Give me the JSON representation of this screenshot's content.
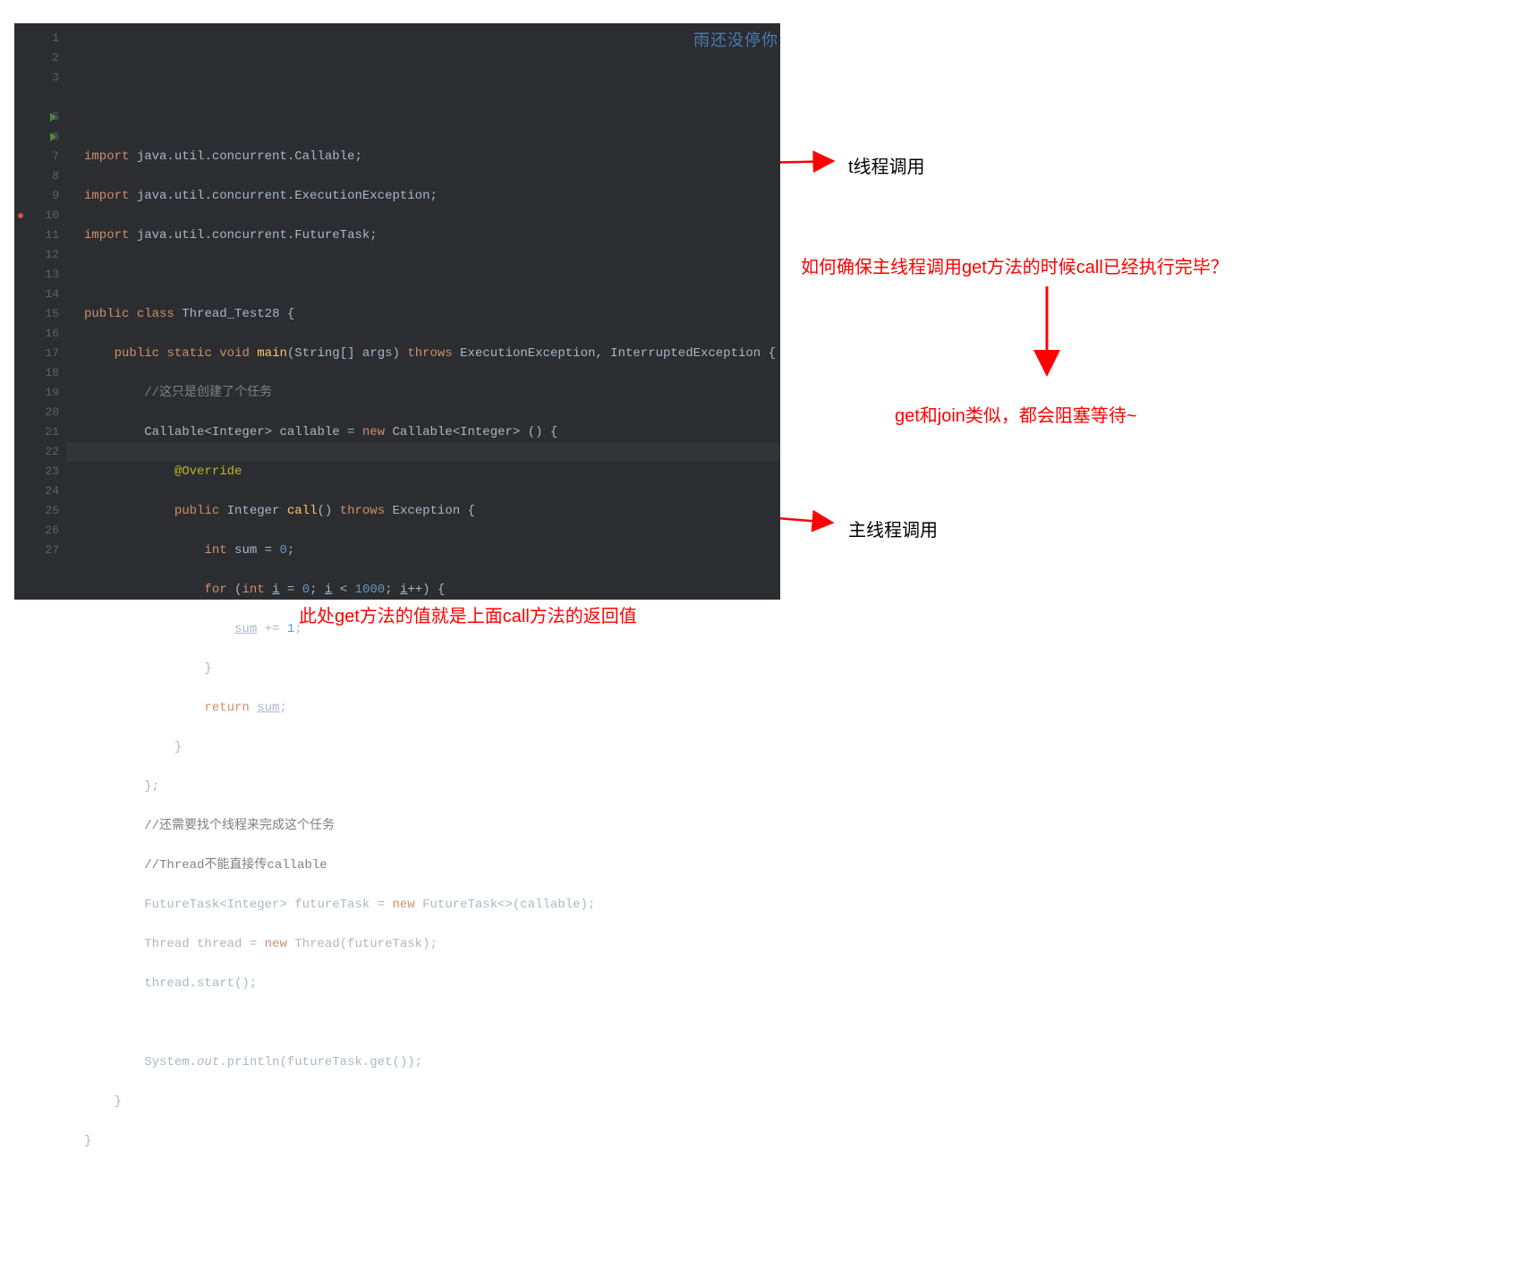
{
  "watermark": "雨还没停你",
  "lines": {
    "l1": {
      "num": "1",
      "imp": "import",
      "pkg": "java.util.concurrent.Callable;"
    },
    "l2": {
      "num": "2",
      "imp": "import",
      "pkg": "java.util.concurrent.ExecutionException;"
    },
    "l3": {
      "num": "3",
      "imp": "import",
      "pkg": "java.util.concurrent.FutureTask;"
    },
    "l4": {
      "num": ""
    },
    "l5": {
      "num": "5",
      "a": "public",
      "b": "class",
      "c": "Thread_Test28",
      "d": "{"
    },
    "l6": {
      "num": "6",
      "a": "public",
      "b": "static",
      "c": "void",
      "d": "main",
      "e": "(String[] args)",
      "f": "throws",
      "g": "ExecutionException, InterruptedException {"
    },
    "l7": {
      "num": "7",
      "cmt": "//这只是创建了个任务"
    },
    "l8": {
      "num": "8",
      "a": "Callable<Integer> callable = ",
      "b": "new",
      "c": " Callable<Integer> () {"
    },
    "l9": {
      "num": "9",
      "ann": "@Override"
    },
    "l10": {
      "num": "10",
      "a": "public",
      "b": " Integer ",
      "c": "call",
      "d": "() ",
      "e": "throws",
      "f": " Exception {"
    },
    "l11": {
      "num": "11",
      "a": "int",
      "b": " sum = ",
      "c": "0",
      "d": ";"
    },
    "l12": {
      "num": "12",
      "a": "for",
      "b": " (",
      "c": "int",
      "d": " ",
      "e": "i",
      "f": " = ",
      "g": "0",
      "h": "; ",
      "i": "i",
      "j": " < ",
      "k": "1000",
      "l": "; ",
      "m": "i",
      "n": "++) {"
    },
    "l13": {
      "num": "13",
      "a": "sum",
      "b": " += ",
      "c": "1",
      "d": ";"
    },
    "l14": {
      "num": "14",
      "a": "}"
    },
    "l15": {
      "num": "15",
      "a": "return",
      "b": " ",
      "c": "sum",
      "d": ";"
    },
    "l16": {
      "num": "16",
      "a": "}"
    },
    "l17": {
      "num": "17",
      "a": "};"
    },
    "l18": {
      "num": "18",
      "cmt": "//还需要找个线程来完成这个任务"
    },
    "l19": {
      "num": "19",
      "cmt": "//Thread不能直接传callable"
    },
    "l20": {
      "num": "20",
      "a": "FutureTask<Integer> futureTask = ",
      "b": "new",
      "c": " FutureTask<>(callable);"
    },
    "l21": {
      "num": "21",
      "a": "Thread thread = ",
      "b": "new",
      "c": " Thread(futureTask);"
    },
    "l22": {
      "num": "22",
      "a": "thread.start();"
    },
    "l23": {
      "num": "23"
    },
    "l24": {
      "num": "24",
      "a": "System.",
      "b": "out",
      "c": ".println(futureTask.get());"
    },
    "l25": {
      "num": "25",
      "a": "}"
    },
    "l26": {
      "num": "26",
      "a": "}"
    },
    "l27": {
      "num": "27"
    }
  },
  "annotations": {
    "a1": "t线程调用",
    "a2": "如何确保主线程调用get方法的时候call已经执行完毕？",
    "a3": "get和join类似，都会阻塞等待~",
    "a4": "主线程调用",
    "a5": "此处get方法的值就是上面call方法的返回值"
  }
}
